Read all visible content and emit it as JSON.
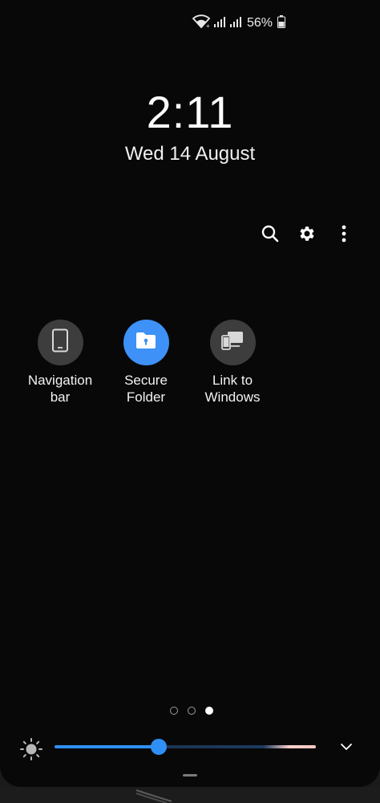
{
  "status_bar": {
    "wifi_icon": "wifi-icon",
    "signal_icon_1": "signal-bars-icon",
    "signal_icon_2": "signal-bars-icon",
    "battery_percent": "56%",
    "battery_icon": "battery-icon"
  },
  "clock": {
    "time": "2:11",
    "date": "Wed 14 August"
  },
  "toolbar": {
    "search_icon": "search-icon",
    "settings_icon": "gear-icon",
    "more_icon": "more-vertical-icon"
  },
  "quick_tiles": [
    {
      "label": "Navigation\nbar",
      "icon": "phone-navigation-icon",
      "active": false
    },
    {
      "label": "Secure\nFolder",
      "icon": "secure-folder-icon",
      "active": true
    },
    {
      "label": "Link to\nWindows",
      "icon": "link-to-windows-icon",
      "active": false
    }
  ],
  "pager": {
    "pages": 3,
    "current": 3
  },
  "brightness": {
    "icon": "brightness-sun-icon",
    "level": 0.4,
    "expand_icon": "chevron-down-icon"
  },
  "colors": {
    "accent": "#2f8ff5",
    "secure_folder": "#3e91f7",
    "tile_inactive": "#3d3d3d",
    "panel_bg": "#080808"
  }
}
